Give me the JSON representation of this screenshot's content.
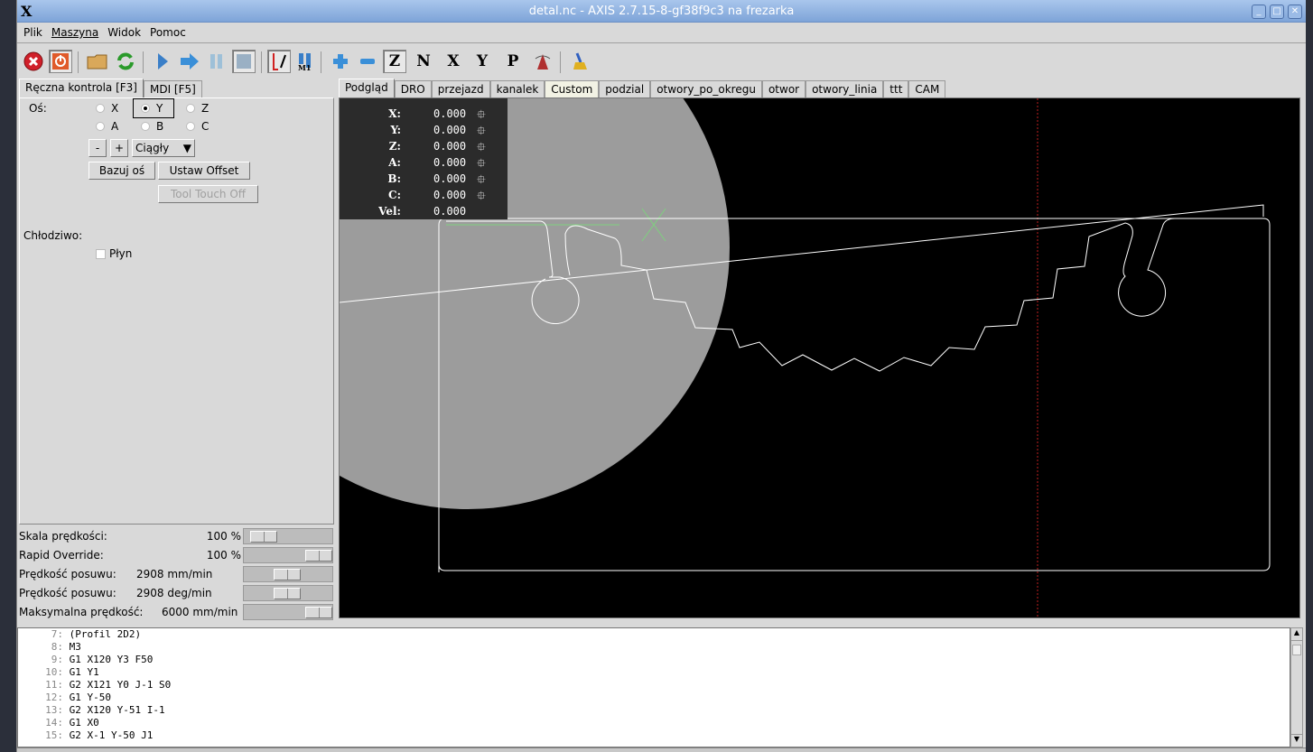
{
  "window": {
    "title": "detal.nc - AXIS 2.7.15-8-gf38f9c3 na frezarka",
    "logo": "X"
  },
  "menu": [
    "Plik",
    "Maszyna",
    "Widok",
    "Pomoc"
  ],
  "toolbar": [
    {
      "icon": "estop-icon",
      "color": "#d0202a"
    },
    {
      "icon": "power-icon",
      "color": "#e05a2a"
    },
    {
      "icon": "open-folder-icon"
    },
    {
      "icon": "reload-icon"
    },
    {
      "icon": "run-icon"
    },
    {
      "icon": "step-icon"
    },
    {
      "icon": "pause-icon"
    },
    {
      "icon": "stop-icon"
    },
    {
      "icon": "block-delete-icon"
    },
    {
      "icon": "optional-stop-icon",
      "label": "M1"
    },
    {
      "icon": "zoom-in-icon"
    },
    {
      "icon": "zoom-out-icon"
    },
    {
      "icon": "view-z-icon",
      "label": "Z"
    },
    {
      "icon": "view-z2-icon",
      "label": "N"
    },
    {
      "icon": "view-x-icon",
      "label": "X"
    },
    {
      "icon": "view-y-icon",
      "label": "Y"
    },
    {
      "icon": "view-p-icon",
      "label": "P"
    },
    {
      "icon": "rotate-icon"
    },
    {
      "icon": "clear-plot-icon"
    }
  ],
  "left_tabs": [
    "Ręczna kontrola [F3]",
    "MDI [F5]"
  ],
  "manual": {
    "axis_label": "Oś:",
    "axes": [
      "X",
      "Y",
      "Z",
      "A",
      "B",
      "C"
    ],
    "selected_axis": "Y",
    "minus": "-",
    "plus": "+",
    "jog_mode": "Ciągły",
    "home_button": "Bazuj oś",
    "offset_button": "Ustaw Offset",
    "touch_off_button": "Tool Touch Off",
    "coolant_label": "Chłodziwo:",
    "flood_label": "Płyn",
    "flood_checked": false
  },
  "sliders": [
    {
      "label": "Skala prędkości:",
      "value": "100 %",
      "level": 0.1
    },
    {
      "label": "Rapid Override:",
      "value": "100 %",
      "level": 1.0
    },
    {
      "label": "Prędkość posuwu:",
      "value": "2908 mm/min",
      "level": 0.48
    },
    {
      "label": "Prędkość posuwu:",
      "value": "2908 deg/min",
      "level": 0.48
    },
    {
      "label": "Maksymalna prędkość:",
      "value": "6000 mm/min",
      "level": 1.0
    }
  ],
  "right_tabs": [
    "Podgląd",
    "DRO",
    "przejazd",
    "kanalek",
    "Custom",
    "podzial",
    "otwory_po_okregu",
    "otwor",
    "otwory_linia",
    "ttt",
    "CAM"
  ],
  "dro": [
    {
      "axis": "X:",
      "value": "0.000"
    },
    {
      "axis": "Y:",
      "value": "0.000"
    },
    {
      "axis": "Z:",
      "value": "0.000"
    },
    {
      "axis": "A:",
      "value": "0.000"
    },
    {
      "axis": "B:",
      "value": "0.000"
    },
    {
      "axis": "C:",
      "value": "0.000"
    },
    {
      "axis": "Vel:",
      "value": "0.000"
    }
  ],
  "code": [
    {
      "n": "7:",
      "text": "(Profil 2D2)"
    },
    {
      "n": "8:",
      "text": "M3"
    },
    {
      "n": "9:",
      "text": "G1 X120 Y3 F50"
    },
    {
      "n": "10:",
      "text": "G1 Y1"
    },
    {
      "n": "11:",
      "text": "G2 X121 Y0 J-1 S0"
    },
    {
      "n": "12:",
      "text": "G1 Y-50"
    },
    {
      "n": "13:",
      "text": "G2 X120 Y-51 I-1"
    },
    {
      "n": "14:",
      "text": "G1 X0"
    },
    {
      "n": "15:",
      "text": "G2 X-1 Y-50 J1"
    }
  ]
}
